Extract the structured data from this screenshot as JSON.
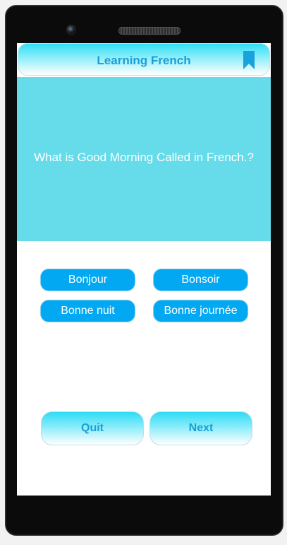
{
  "header": {
    "title": "Learning French",
    "bookmark_icon": "bookmark-icon",
    "accent_color": "#1a9fd6"
  },
  "question": {
    "text": "What is Good Morning Called in French.?",
    "panel_color": "#66dbe9"
  },
  "options": [
    {
      "label": "Bonjour"
    },
    {
      "label": "Bonsoir"
    },
    {
      "label": "Bonne nuit"
    },
    {
      "label": "Bonne journée"
    }
  ],
  "actions": {
    "quit_label": "Quit",
    "next_label": "Next"
  },
  "colors": {
    "option_bg": "#02a8f1",
    "option_text": "#ffffff"
  }
}
